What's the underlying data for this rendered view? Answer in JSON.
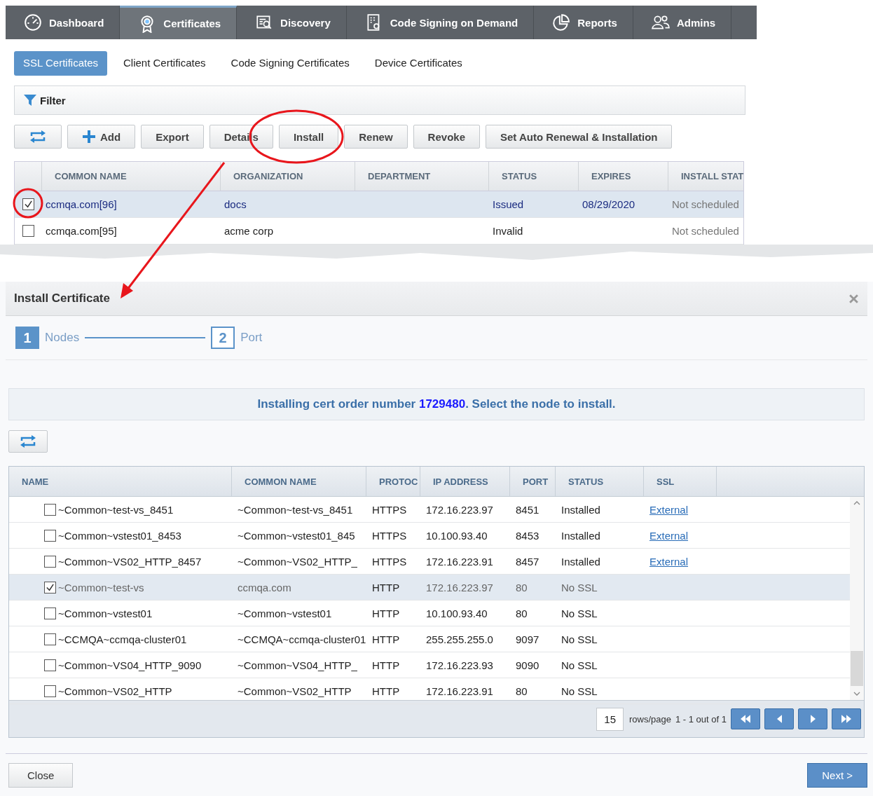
{
  "nav": {
    "tabs": [
      {
        "label": "Dashboard",
        "kind": "gauge",
        "selected": false
      },
      {
        "label": "Certificates",
        "kind": "badge",
        "selected": true
      },
      {
        "label": "Discovery",
        "kind": "scan",
        "selected": false
      },
      {
        "label": "Code Signing on Demand",
        "kind": "document",
        "selected": false
      },
      {
        "label": "Reports",
        "kind": "pie",
        "selected": false
      },
      {
        "label": "Admins",
        "kind": "people",
        "selected": false
      }
    ]
  },
  "subtabs": [
    {
      "label": "SSL Certificates",
      "selected": true
    },
    {
      "label": "Client Certificates",
      "selected": false
    },
    {
      "label": "Code Signing Certificates",
      "selected": false
    },
    {
      "label": "Device Certificates",
      "selected": false
    }
  ],
  "filter": {
    "label": "Filter"
  },
  "toolbar": [
    {
      "kind": "refresh"
    },
    {
      "kind": "add",
      "label": "Add"
    },
    {
      "kind": "text",
      "label": "Export"
    },
    {
      "kind": "text",
      "label": "Details"
    },
    {
      "kind": "text",
      "label": "Install"
    },
    {
      "kind": "text",
      "label": "Renew"
    },
    {
      "kind": "text",
      "label": "Revoke"
    },
    {
      "kind": "text",
      "label": "Set Auto Renewal & Installation"
    }
  ],
  "certificates": {
    "columns": [
      "COMMON NAME",
      "ORGANIZATION",
      "DEPARTMENT",
      "STATUS",
      "EXPIRES",
      "INSTALL STAT"
    ],
    "rows": [
      {
        "checked": true,
        "selected": true,
        "cells": [
          "ccmqa.com[96]",
          "docs",
          "",
          "Issued",
          "08/29/2020",
          "Not scheduled"
        ]
      },
      {
        "checked": false,
        "selected": false,
        "cells": [
          "ccmqa.com[95]",
          "acme corp",
          "",
          "Invalid",
          "",
          "Not scheduled"
        ]
      }
    ]
  },
  "dialog": {
    "title": "Install Certificate",
    "steps": [
      {
        "number": "1",
        "label": "Nodes",
        "selected": true
      },
      {
        "number": "2",
        "label": "Port",
        "selected": false
      }
    ],
    "message": {
      "before": "Installing cert order number ",
      "number": "1729480",
      "after": ". Select the node to install."
    },
    "columns": [
      "NAME",
      "COMMON NAME",
      "PROTOC",
      "IP ADDRESS",
      "PORT",
      "STATUS",
      "SSL"
    ],
    "rows": [
      {
        "checked": false,
        "selected": false,
        "cells": [
          "~Common~test-vs_8451",
          "~Common~test-vs_8451",
          "HTTPS",
          "172.16.223.97",
          "8451",
          "Installed"
        ],
        "ssl": "External"
      },
      {
        "checked": false,
        "selected": false,
        "cells": [
          "~Common~vstest01_8453",
          "~Common~vstest01_845",
          "HTTPS",
          "10.100.93.40",
          "8453",
          "Installed"
        ],
        "ssl": "External"
      },
      {
        "checked": false,
        "selected": false,
        "cells": [
          "~Common~VS02_HTTP_8457",
          "~Common~VS02_HTTP_",
          "HTTPS",
          "172.16.223.91",
          "8457",
          "Installed"
        ],
        "ssl": "External"
      },
      {
        "checked": true,
        "selected": true,
        "cells": [
          "~Common~test-vs",
          "ccmqa.com",
          "HTTP",
          "172.16.223.97",
          "80",
          "No SSL"
        ]
      },
      {
        "checked": false,
        "selected": false,
        "cells": [
          "~Common~vstest01",
          "~Common~vstest01",
          "HTTP",
          "10.100.93.40",
          "80",
          "No SSL"
        ]
      },
      {
        "checked": false,
        "selected": false,
        "cells": [
          "~CCMQA~ccmqa-cluster01",
          "~CCMQA~ccmqa-cluster01",
          "HTTP",
          "255.255.255.0",
          "9097",
          "No SSL"
        ]
      },
      {
        "checked": false,
        "selected": false,
        "cells": [
          "~Common~VS04_HTTP_9090",
          "~Common~VS04_HTTP_",
          "HTTP",
          "172.16.223.93",
          "9090",
          "No SSL"
        ]
      },
      {
        "checked": false,
        "selected": false,
        "cells": [
          "~Common~VS02_HTTP",
          "~Common~VS02_HTTP",
          "HTTP",
          "172.16.223.91",
          "80",
          "No SSL"
        ]
      }
    ],
    "pager": {
      "rows_per_page": "15",
      "rows_label": "rows/page",
      "range": "1 - 1 out of 1",
      "buttons": [
        {
          "kind": "first"
        },
        {
          "kind": "prev"
        },
        {
          "kind": "next"
        },
        {
          "kind": "last"
        }
      ]
    },
    "buttons": [
      {
        "kind": "close",
        "label": "Close"
      },
      {
        "kind": "next",
        "label": "Next >"
      }
    ]
  }
}
